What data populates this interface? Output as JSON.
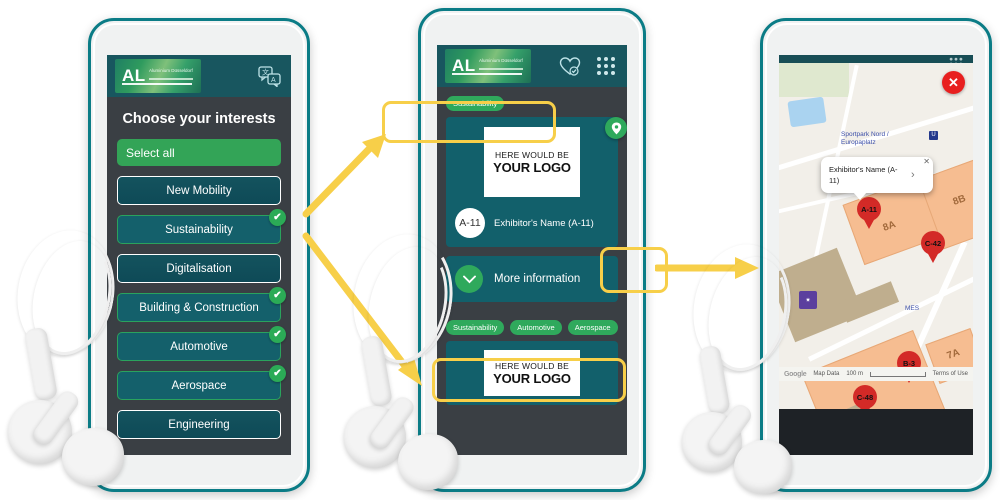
{
  "app": {
    "logo_text": "AL",
    "logo_sub": "Aluminium Düsseldorf",
    "translate_icon": "translate-icon",
    "heart_icon": "heart-check-icon",
    "grid_icon": "grid-dots-icon"
  },
  "phone1": {
    "title": "Choose your interests",
    "select_all": "Select all",
    "interests": [
      {
        "label": "New Mobility",
        "selected": false
      },
      {
        "label": "Sustainability",
        "selected": true
      },
      {
        "label": "Digitalisation",
        "selected": false
      },
      {
        "label": "Building & Construction",
        "selected": true
      },
      {
        "label": "Automotive",
        "selected": true
      },
      {
        "label": "Aerospace",
        "selected": true
      },
      {
        "label": "Engineering",
        "selected": false
      }
    ],
    "check_glyph": "✔"
  },
  "phone2": {
    "top_tag": "Sustainability",
    "logo_placeholder_line1": "HERE WOULD BE",
    "logo_placeholder_line2": "YOUR LOGO",
    "exhibitor_badge": "A-11",
    "exhibitor_name": "Exhibitor's Name (A-11)",
    "more_information": "More information",
    "chevron_glyph": "⌄",
    "pin_glyph": "◉",
    "tags": [
      "Sustainability",
      "Automotive",
      "Aerospace"
    ],
    "second_card_line1": "HERE WOULD BE",
    "second_card_line2": "YOUR LOGO"
  },
  "phone3": {
    "close_glyph": "✕",
    "callout": {
      "text": "Exhibitor's Name (A-11)",
      "close_glyph": "✕",
      "chevron_glyph": "›"
    },
    "markers": [
      {
        "label": "A-11"
      },
      {
        "label": "C-42"
      },
      {
        "label": "B-3"
      },
      {
        "label": "C-48"
      }
    ],
    "hall_labels": [
      "8A",
      "8B",
      "7A"
    ],
    "poi_label": "Sportpark Nord / Europaplatz",
    "poi_label2": "MES",
    "subway_glyph": "U",
    "footer": {
      "brand": "Google",
      "map_data": "Map Data",
      "scale": "100 m",
      "terms": "Terms of Use"
    }
  },
  "annotations": {
    "colors": {
      "highlight": "#f7cf49",
      "accent_green": "#2fa95c",
      "teal": "#12606b",
      "phone_edge": "#0b7c86"
    }
  }
}
